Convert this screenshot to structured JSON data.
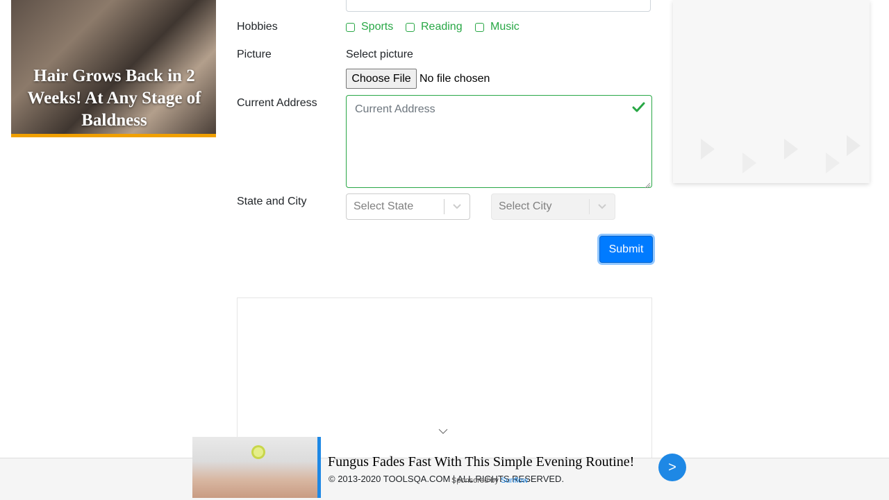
{
  "form": {
    "hobbies": {
      "label": "Hobbies",
      "options": [
        "Sports",
        "Reading",
        "Music"
      ]
    },
    "picture": {
      "label": "Picture",
      "select_label": "Select picture",
      "button_label": "Choose File",
      "status": "No file chosen"
    },
    "address": {
      "label": "Current Address",
      "placeholder": "Current Address"
    },
    "state_city": {
      "label": "State and City",
      "state_placeholder": "Select State",
      "city_placeholder": "Select City"
    },
    "submit_label": "Submit"
  },
  "right_ad": {
    "headline": "Hair Grows Back in 2 Weeks! At Any Stage of Baldness"
  },
  "footer": {
    "copyright": "© 2013-2020 TOOLSQA.COM | ALL RIGHTS RESERVED."
  },
  "bottom_ad": {
    "title": "Fungus Fades Fast With This Simple Evening Routine!",
    "sponsor_prefix": "Sponsored by ",
    "sponsor_name": "Sunflow",
    "next_label": ">"
  },
  "colors": {
    "valid_green": "#28a745",
    "primary_blue": "#007bff",
    "ad_accent_orange": "#f0a000",
    "ad_blue": "#1e88e5"
  }
}
